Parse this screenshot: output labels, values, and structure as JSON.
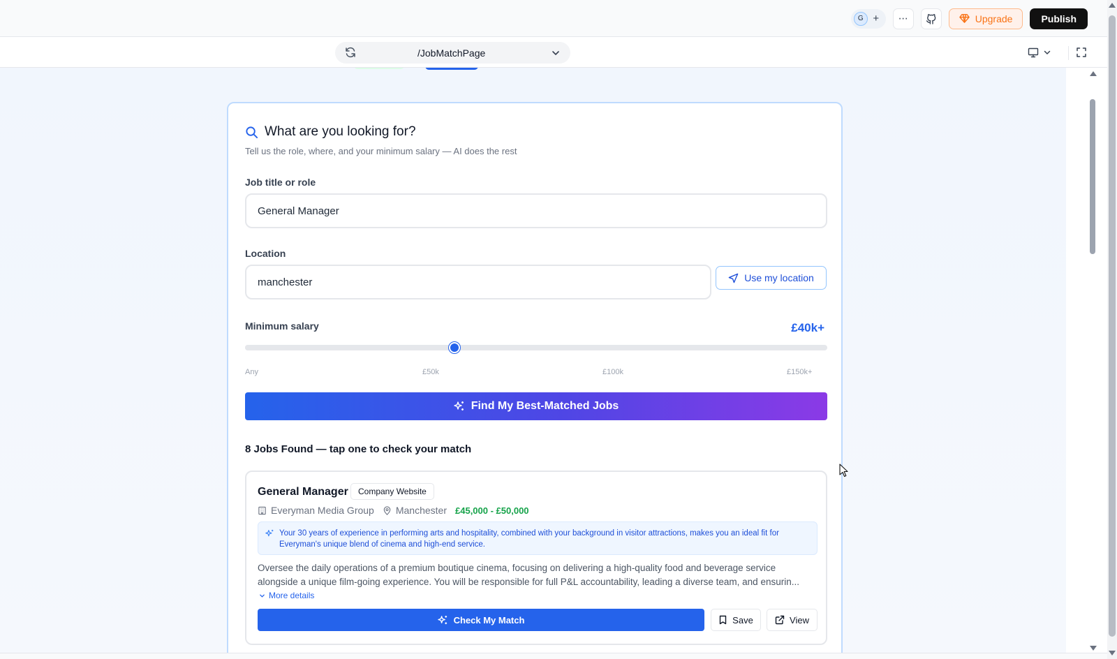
{
  "topbar": {
    "avatar_initial": "G",
    "avatar_add": "+",
    "more_icon": "⋯",
    "upgrade_label": "Upgrade",
    "publish_label": "Publish"
  },
  "urlbar": {
    "path": "/JobMatchPage"
  },
  "search_card": {
    "title": "What are you looking for?",
    "subtitle": "Tell us the role, where, and your minimum salary — AI does the rest",
    "job_label": "Job title or role",
    "job_value": "General Manager",
    "location_label": "Location",
    "location_value": "manchester",
    "use_location_label": "Use my location",
    "salary_label": "Minimum salary",
    "salary_value": "£40k+",
    "salary_level_pct": 36,
    "ticks": [
      "Any",
      "£50k",
      "£100k",
      "£150k+"
    ],
    "find_button": "Find My Best-Matched Jobs",
    "jobs_found": "8 Jobs Found — tap one to check your match"
  },
  "job": {
    "title": "General Manager",
    "source": "Company Website",
    "company": "Everyman Media Group",
    "location": "Manchester",
    "salary": "£45,000 - £50,000",
    "ai_reason": "Your 30 years of experience in performing arts and hospitality, combined with your background in visitor attractions, makes you an ideal fit for Everyman's unique blend of cinema and high-end service.",
    "description": "Oversee the daily operations of a premium boutique cinema, focusing on delivering a high-quality food and beverage service alongside a unique film-going experience. You will be responsible for full P&L accountability, leading a diverse team, and ensurin...",
    "more_details": "More details",
    "check_button": "Check My Match",
    "save_button": "Save",
    "view_button": "View"
  },
  "colors": {
    "accent": "#2563eb",
    "gradient_end": "#8b3ae6",
    "salary_green": "#16a34a",
    "upgrade_orange": "#f97316"
  }
}
